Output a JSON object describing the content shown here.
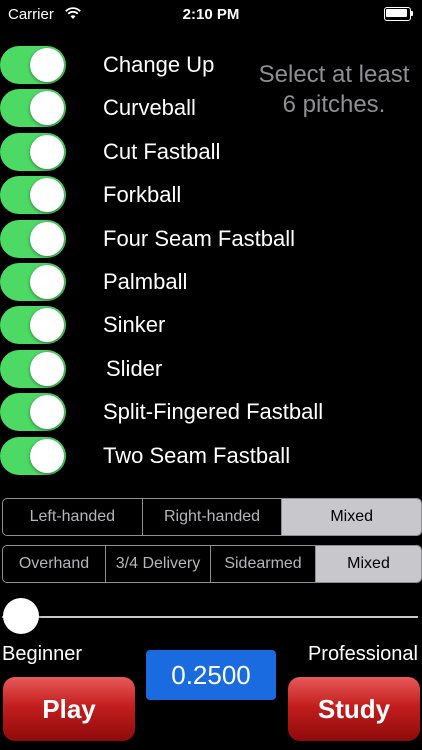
{
  "status_bar": {
    "carrier": "Carrier",
    "time": "2:10 PM"
  },
  "pitches": [
    {
      "label": "Change Up",
      "on": true
    },
    {
      "label": "Curveball",
      "on": true
    },
    {
      "label": "Cut Fastball",
      "on": true
    },
    {
      "label": "Forkball",
      "on": true
    },
    {
      "label": "Four Seam Fastball",
      "on": true
    },
    {
      "label": "Palmball",
      "on": true
    },
    {
      "label": "Sinker",
      "on": true
    },
    {
      "label": "Slider",
      "on": true
    },
    {
      "label": "Split-Fingered Fastball",
      "on": true
    },
    {
      "label": "Two Seam Fastball",
      "on": true
    }
  ],
  "hint": {
    "line1": "Select at least",
    "line2": "6 pitches."
  },
  "handedness": {
    "options": [
      "Left-handed",
      "Right-handed",
      "Mixed"
    ],
    "selected": "Mixed"
  },
  "delivery": {
    "options": [
      "Overhand",
      "3/4 Delivery",
      "Sidearmed",
      "Mixed"
    ],
    "selected": "Mixed"
  },
  "level": {
    "min_label": "Beginner",
    "max_label": "Professional",
    "value": "0.2500",
    "slider_fraction": 0.0
  },
  "buttons": {
    "play": "Play",
    "study": "Study"
  },
  "colors": {
    "toggle_on": "#4cd964",
    "value_box": "#1a6be0",
    "button_red": "#c41e1e"
  }
}
